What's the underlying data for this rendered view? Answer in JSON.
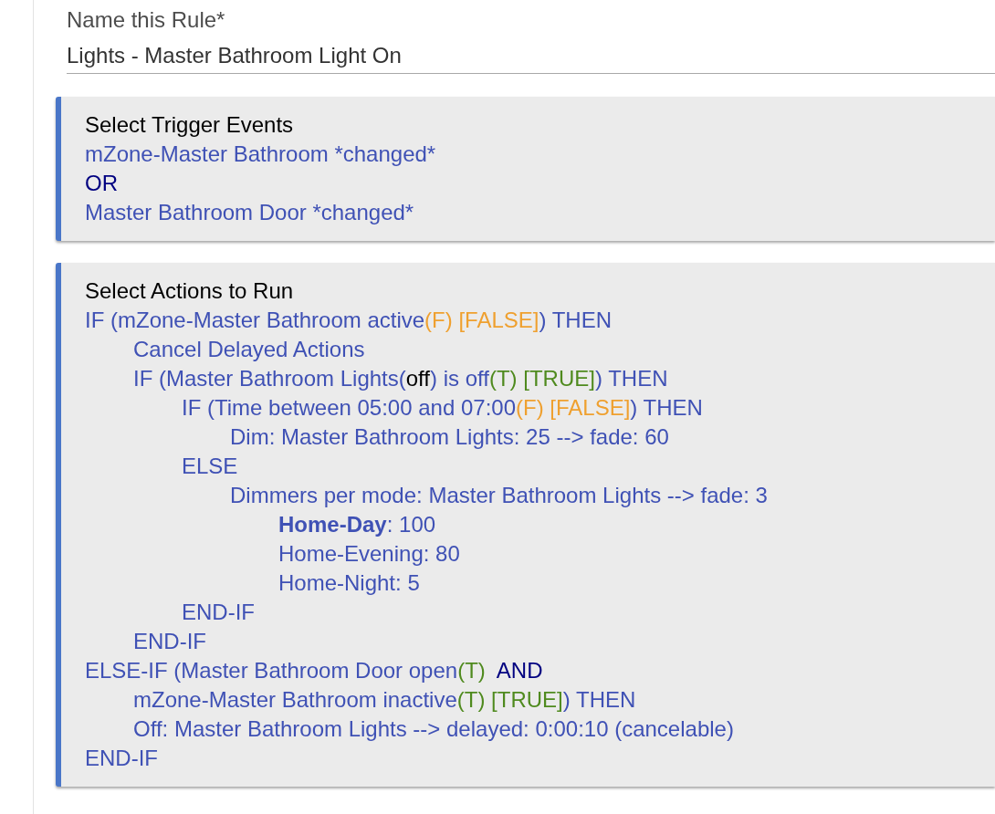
{
  "rule_name": {
    "label": "Name this Rule*",
    "value": "Lights - Master Bathroom Light On"
  },
  "trigger_events": {
    "title": "Select Trigger Events",
    "lines": [
      {
        "parts": [
          {
            "kind": "plain",
            "text": "mZone-Master Bathroom *changed*"
          }
        ]
      },
      {
        "parts": [
          {
            "kind": "operator",
            "text": "OR"
          }
        ]
      },
      {
        "parts": [
          {
            "kind": "plain",
            "text": "Master Bathroom Door *changed*"
          }
        ]
      }
    ]
  },
  "actions": {
    "title": "Select Actions to Run",
    "lines": [
      {
        "parts": [
          {
            "kind": "plain",
            "text": "IF (mZone-Master Bathroom active"
          },
          {
            "kind": "false",
            "text": "(F) [FALSE]"
          },
          {
            "kind": "plain",
            "text": ") THEN"
          }
        ],
        "children": [
          {
            "parts": [
              {
                "kind": "plain",
                "text": "Cancel Delayed Actions"
              }
            ]
          },
          {
            "parts": [
              {
                "kind": "plain",
                "text": "IF (Master Bathroom Lights("
              },
              {
                "kind": "value",
                "text": "off"
              },
              {
                "kind": "plain",
                "text": ") is off"
              },
              {
                "kind": "true",
                "text": "(T) [TRUE]"
              },
              {
                "kind": "plain",
                "text": ") THEN"
              }
            ],
            "children": [
              {
                "parts": [
                  {
                    "kind": "plain",
                    "text": "IF (Time between 05:00 and 07:00"
                  },
                  {
                    "kind": "false",
                    "text": "(F) [FALSE]"
                  },
                  {
                    "kind": "plain",
                    "text": ") THEN"
                  }
                ],
                "children": [
                  {
                    "parts": [
                      {
                        "kind": "plain",
                        "text": "Dim: Master Bathroom Lights: 25 --> fade: 60"
                      }
                    ]
                  }
                ]
              },
              {
                "parts": [
                  {
                    "kind": "plain",
                    "text": "ELSE"
                  }
                ],
                "children": [
                  {
                    "parts": [
                      {
                        "kind": "plain",
                        "text": "Dimmers per mode: Master Bathroom Lights --> fade: 3"
                      }
                    ],
                    "children": [
                      {
                        "parts": [
                          {
                            "kind": "mode",
                            "text": "Home-Day"
                          },
                          {
                            "kind": "plain",
                            "text": ": 100"
                          }
                        ]
                      },
                      {
                        "parts": [
                          {
                            "kind": "plain",
                            "text": "Home-Evening: 80"
                          }
                        ]
                      },
                      {
                        "parts": [
                          {
                            "kind": "plain",
                            "text": "Home-Night: 5"
                          }
                        ]
                      }
                    ]
                  }
                ]
              },
              {
                "parts": [
                  {
                    "kind": "plain",
                    "text": "END-IF"
                  }
                ]
              }
            ]
          },
          {
            "parts": [
              {
                "kind": "plain",
                "text": "END-IF"
              }
            ]
          }
        ]
      },
      {
        "parts": [
          {
            "kind": "plain",
            "text": "ELSE-IF (Master Bathroom Door open"
          },
          {
            "kind": "true",
            "text": "(T)"
          },
          {
            "kind": "operator",
            "text": "  AND"
          }
        ],
        "children": [
          {
            "parts": [
              {
                "kind": "plain",
                "text": "mZone-Master Bathroom inactive"
              },
              {
                "kind": "true",
                "text": "(T) [TRUE]"
              },
              {
                "kind": "plain",
                "text": ") THEN"
              }
            ]
          },
          {
            "parts": [
              {
                "kind": "plain",
                "text": "Off: Master Bathroom Lights --> delayed: 0:00:10 (cancelable)"
              }
            ]
          }
        ]
      },
      {
        "parts": [
          {
            "kind": "plain",
            "text": "END-IF"
          }
        ]
      }
    ]
  }
}
